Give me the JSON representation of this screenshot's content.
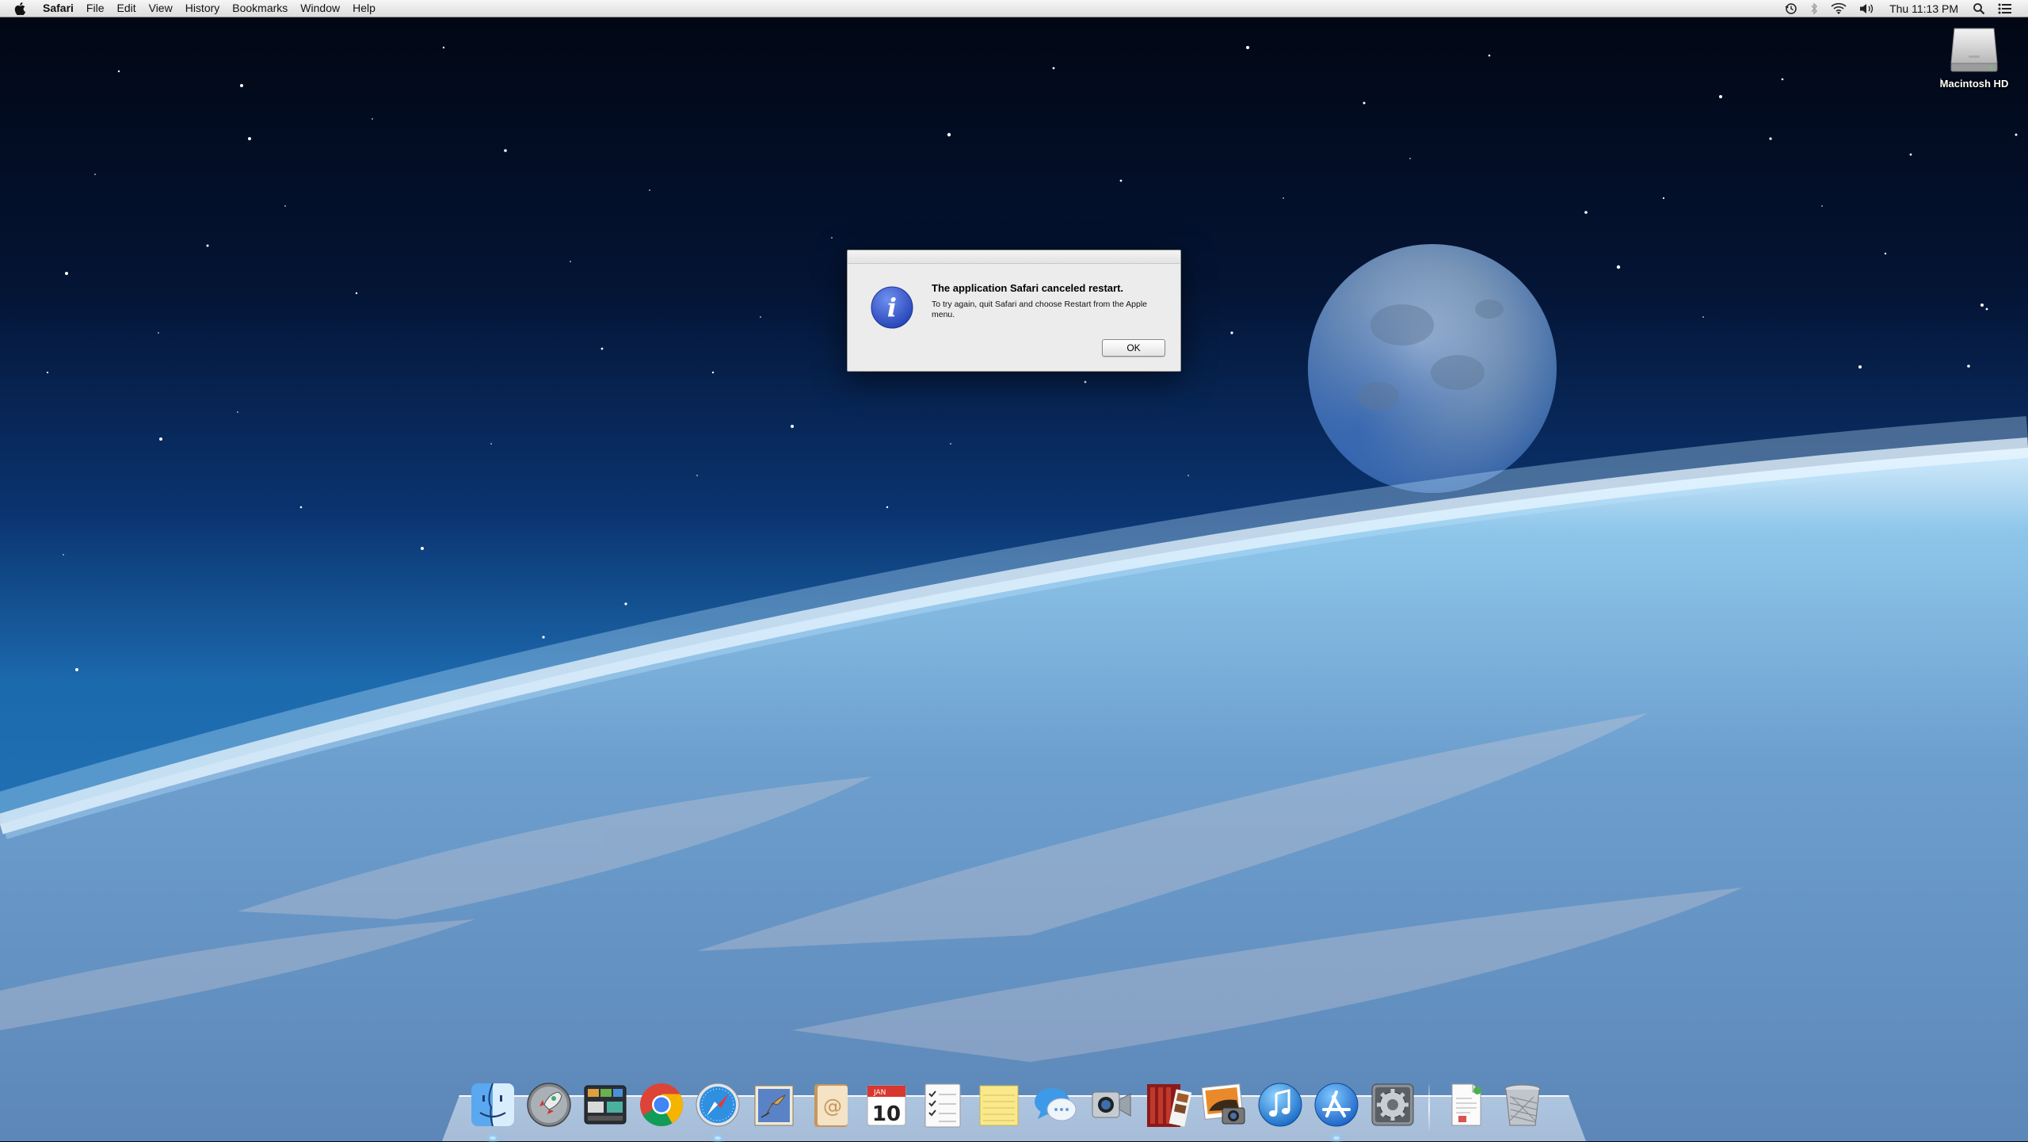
{
  "menubar": {
    "apple_icon": "apple-logo-icon",
    "app_name": "Safari",
    "menus": [
      "File",
      "Edit",
      "View",
      "History",
      "Bookmarks",
      "Window",
      "Help"
    ],
    "status_icons": [
      "time-machine-icon",
      "bluetooth-icon",
      "wifi-icon",
      "volume-icon"
    ],
    "clock": "Thu 11:13 PM",
    "spotlight_icon": "spotlight-search-icon",
    "notification_icon": "notification-center-icon"
  },
  "desktop": {
    "drive_label": "Macintosh HD",
    "wallpaper": "earth-horizon-with-moon"
  },
  "dialog": {
    "icon": "info-icon",
    "title": "The application Safari canceled restart.",
    "message": "To try again, quit Safari and choose Restart from the Apple menu.",
    "ok_label": "OK"
  },
  "dock": {
    "apps": [
      {
        "name": "Finder",
        "icon": "finder-icon",
        "running": true
      },
      {
        "name": "Launchpad",
        "icon": "launchpad-icon",
        "running": false
      },
      {
        "name": "Mission Control",
        "icon": "mission-control-icon",
        "running": false
      },
      {
        "name": "Google Chrome",
        "icon": "chrome-icon",
        "running": false
      },
      {
        "name": "Safari",
        "icon": "safari-icon",
        "running": true
      },
      {
        "name": "Mail",
        "icon": "mail-icon",
        "running": false
      },
      {
        "name": "Contacts",
        "icon": "contacts-icon",
        "running": false
      },
      {
        "name": "Calendar",
        "icon": "calendar-icon",
        "running": false,
        "month": "JAN",
        "day": "10"
      },
      {
        "name": "Reminders",
        "icon": "reminders-icon",
        "running": false
      },
      {
        "name": "Notes",
        "icon": "notes-icon",
        "running": false
      },
      {
        "name": "Messages",
        "icon": "messages-icon",
        "running": false
      },
      {
        "name": "FaceTime",
        "icon": "facetime-icon",
        "running": false
      },
      {
        "name": "Photo Booth",
        "icon": "photo-booth-icon",
        "running": false
      },
      {
        "name": "iPhoto",
        "icon": "iphoto-icon",
        "running": false
      },
      {
        "name": "iTunes",
        "icon": "itunes-icon",
        "running": false
      },
      {
        "name": "App Store",
        "icon": "app-store-icon",
        "running": true
      },
      {
        "name": "System Preferences",
        "icon": "system-preferences-icon",
        "running": false
      }
    ],
    "others": [
      {
        "name": "Document",
        "icon": "document-icon"
      },
      {
        "name": "Trash",
        "icon": "trash-icon"
      }
    ]
  },
  "colors": {
    "space": "#02081a",
    "atmosphere": "#7fc8f0",
    "dialog_bg": "#ececec",
    "info_blue": "#3b5fd6"
  }
}
